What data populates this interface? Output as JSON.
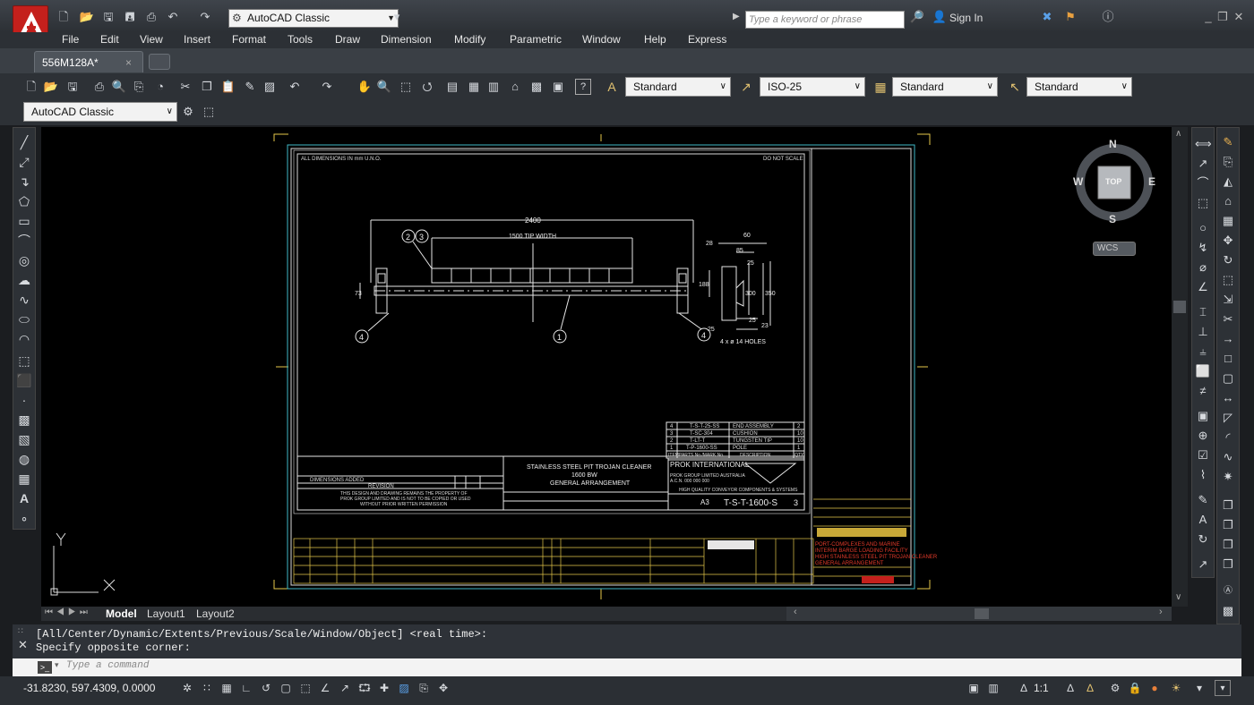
{
  "app": {
    "title_workspace": "AutoCAD Classic",
    "search_placeholder": "Type a keyword or phrase",
    "sign_in": "Sign In",
    "accent": "#c4201c"
  },
  "menu": [
    "File",
    "Edit",
    "View",
    "Insert",
    "Format",
    "Tools",
    "Draw",
    "Dimension",
    "Modify",
    "Parametric",
    "Window",
    "Help",
    "Express"
  ],
  "tabs": {
    "document": "556M128A*",
    "close": "×"
  },
  "styles": {
    "text_style": "Standard",
    "dim_style": "ISO-25",
    "table_style": "Standard",
    "multileader_style": "Standard",
    "workspace": "AutoCAD Classic"
  },
  "viewcube": {
    "n": "N",
    "s": "S",
    "e": "E",
    "w": "W",
    "face": "TOP",
    "wcs": "WCS"
  },
  "layouts": {
    "model": "Model",
    "layout1": "Layout1",
    "layout2": "Layout2"
  },
  "command": {
    "history1": "[All/Center/Dynamic/Extents/Previous/Scale/Window/Object] <real time>:",
    "history2": "Specify opposite corner:",
    "placeholder": "Type a command"
  },
  "status": {
    "coords": "-31.8230, 597.4309, 0.0000",
    "scale": "1:1"
  },
  "drawing": {
    "note_units": "ALL DIMENSIONS IN mm U.N.O.",
    "note_scale": "DO NOT SCALE",
    "dim_overall": "2400",
    "dim_tip": "1500 TIP WIDTH",
    "dim_73": "73",
    "dim_28": "28",
    "dim_60": "60",
    "dim_85": "85",
    "dim_25a": "25",
    "dim_188": "188",
    "dim_300": "300",
    "dim_350": "350",
    "dim_25b": "25",
    "dim_25c": "25",
    "dim_23": "23",
    "holes": "4 x ø 14 HOLES",
    "balloons": [
      "2",
      "3",
      "4",
      "1",
      "4"
    ],
    "title_line1": "STAINLESS STEEL PIT TROJAN CLEANER",
    "title_line2": "1600 BW",
    "title_line3": "GENERAL ARRANGEMENT",
    "company": "PROK INTERNATIONAL",
    "company_sub1": "PROK GROUP LIMITED AUSTRALIA",
    "company_sub2": "A.C.N. 000 000 000",
    "company_tag": "HIGH QUALITY CONVEYOR COMPONENTS & SYSTEMS",
    "drawing_no": "T-S-T-1600-S",
    "sheet": "A3",
    "rev": "3",
    "rev_row": "DIMENSIONS ADDED",
    "rev_header": "REVISION",
    "copyright1": "THIS DESIGN AND DRAWING REMAINS THE PROPERTY OF",
    "copyright2": "PROK GROUP LIMITED AND IS NOT TO BE COPIED OR USED",
    "copyright3": "WITHOUT PRIOR WRITTEN PERMISSION",
    "bom": [
      {
        "item": "4",
        "part": "T-S-T-25-SS",
        "desc": "END ASSEMBLY",
        "qty": "2"
      },
      {
        "item": "3",
        "part": "T-SC-304",
        "desc": "CUSHION",
        "qty": "10"
      },
      {
        "item": "2",
        "part": "T-LT-T",
        "desc": "TUNGSTEN TIP",
        "qty": "10"
      },
      {
        "item": "1",
        "part": "T-P-1600-SS",
        "desc": "POLE",
        "qty": "1"
      }
    ],
    "bom_header": [
      "ITEM",
      "PARTS No./MARK No.",
      "DESCRIPTION",
      "QTY"
    ],
    "client_lines": [
      "PORT-COMPLEXES AND MARINE",
      "INTERIM BARGE LOADING FACILITY",
      "HIGH STAINLESS STEEL PIT TROJAN CLEANER",
      "GENERAL ARRANGEMENT"
    ]
  }
}
